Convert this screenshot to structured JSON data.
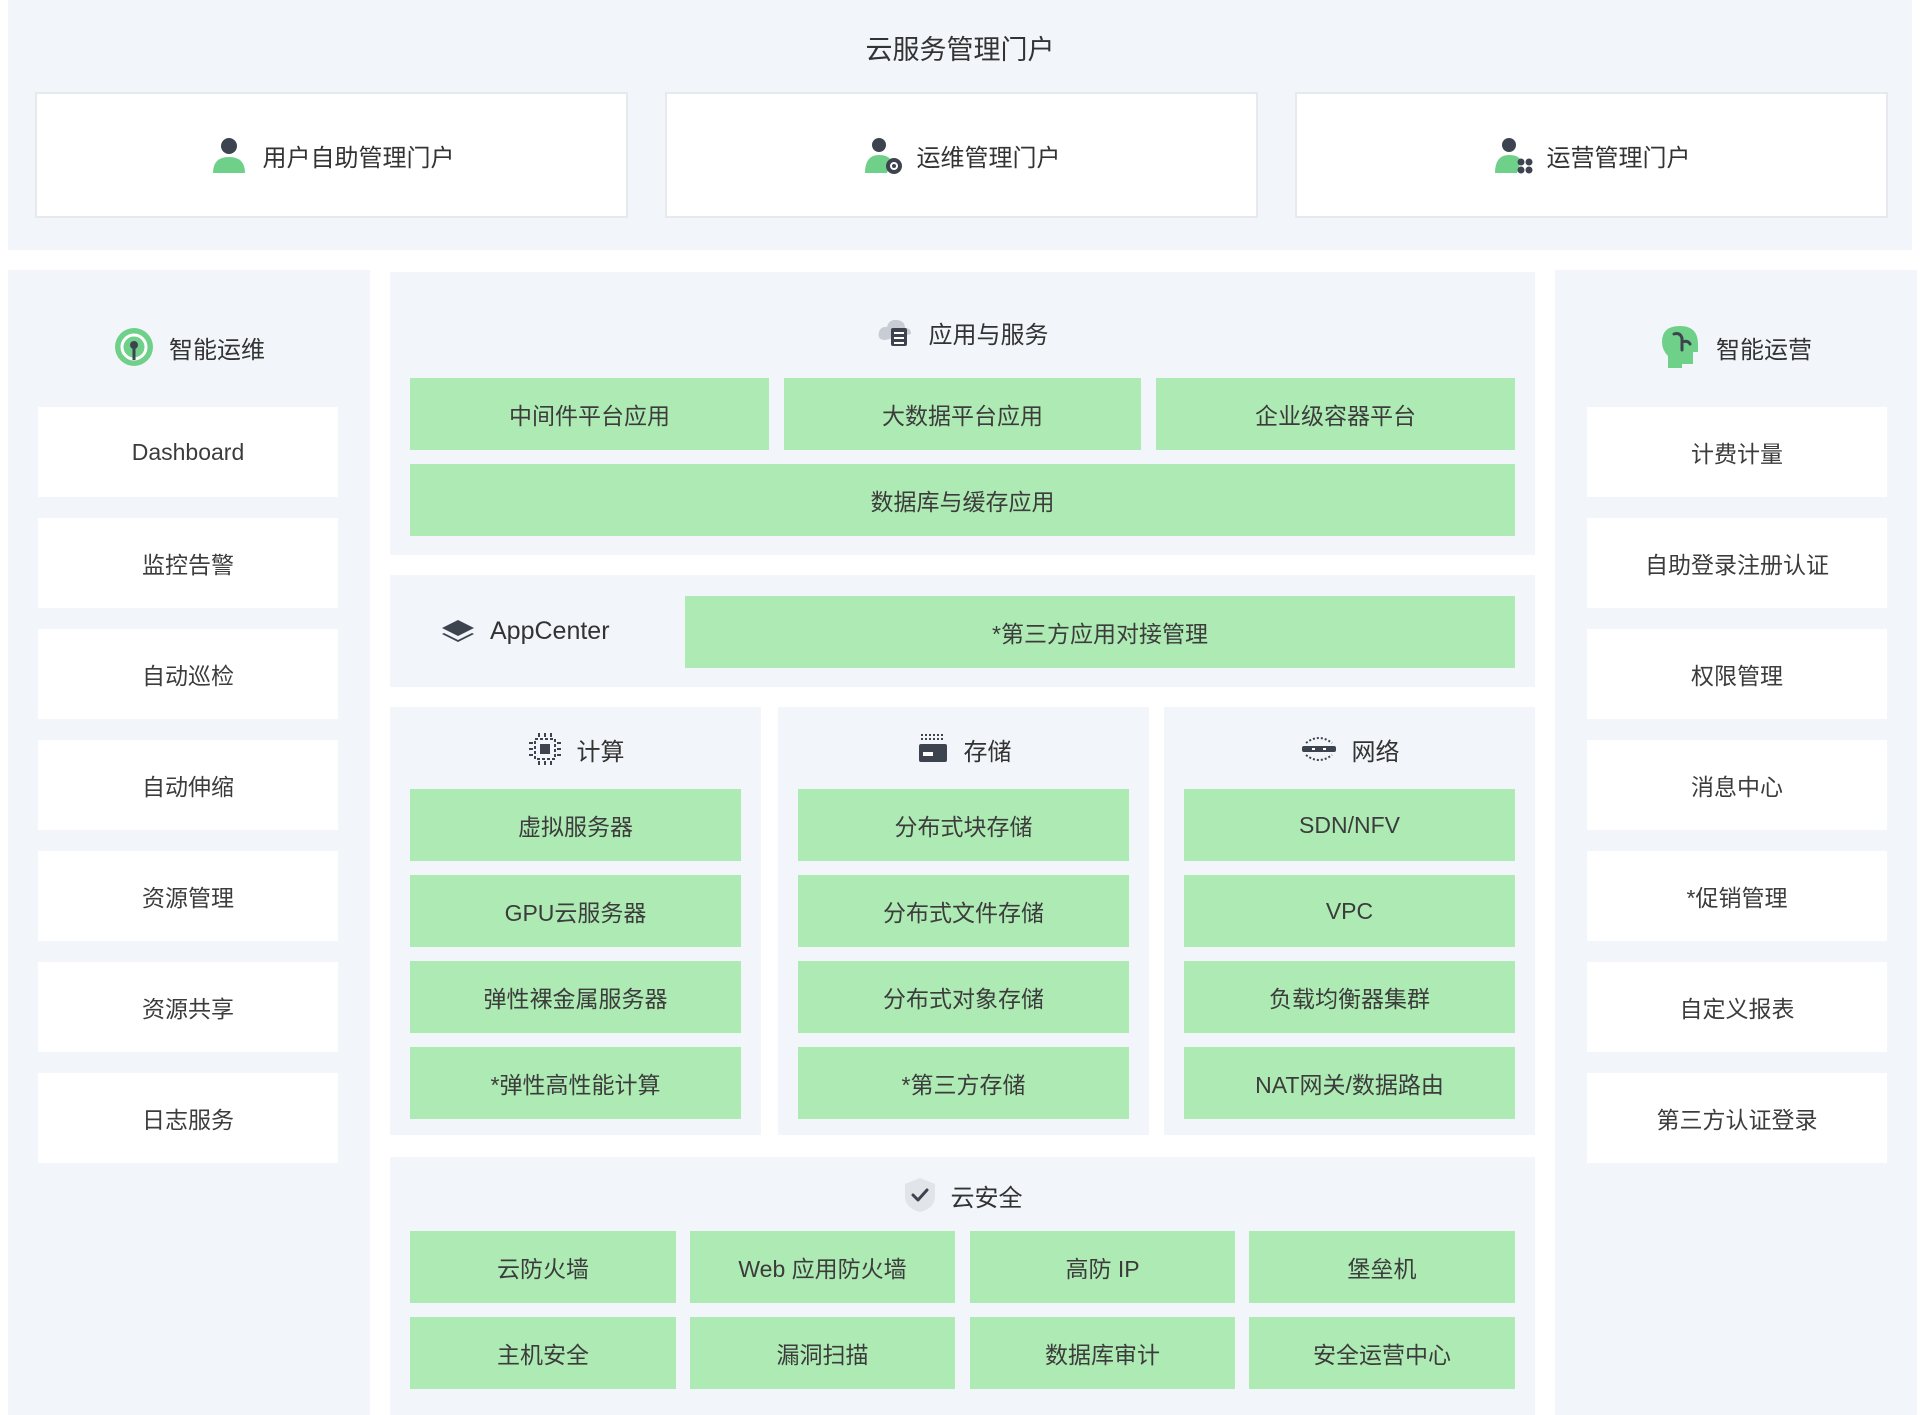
{
  "header": {
    "title": "云服务管理门户"
  },
  "portals": [
    {
      "label": "用户自助管理门户",
      "icon": "user-icon"
    },
    {
      "label": "运维管理门户",
      "icon": "user-gear-icon"
    },
    {
      "label": "运营管理门户",
      "icon": "user-apps-icon"
    }
  ],
  "left": {
    "title": "智能运维",
    "icon": "ops-antenna-icon",
    "items": [
      "Dashboard",
      "监控告警",
      "自动巡检",
      "自动伸缩",
      "资源管理",
      "资源共享",
      "日志服务"
    ]
  },
  "right": {
    "title": "智能运营",
    "icon": "head-brain-icon",
    "items": [
      "计费计量",
      "自助登录注册认证",
      "权限管理",
      "消息中心",
      "*促销管理",
      "自定义报表",
      "第三方认证登录"
    ]
  },
  "apps": {
    "title": "应用与服务",
    "icon": "cloud-server-icon",
    "row1": [
      "中间件平台应用",
      "大数据平台应用",
      "企业级容器平台"
    ],
    "row2": "数据库与缓存应用"
  },
  "appcenter": {
    "label": "AppCenter",
    "icon": "layers-icon",
    "item": "*第三方应用对接管理"
  },
  "compute": {
    "title": "计算",
    "icon": "chip-icon",
    "items": [
      "虚拟服务器",
      "GPU云服务器",
      "弹性裸金属服务器",
      "*弹性高性能计算"
    ]
  },
  "storage": {
    "title": "存储",
    "icon": "storage-icon",
    "items": [
      "分布式块存储",
      "分布式文件存储",
      "分布式对象存储",
      "*第三方存储"
    ]
  },
  "network": {
    "title": "网络",
    "icon": "network-icon",
    "items": [
      "SDN/NFV",
      "VPC",
      "负载均衡器集群",
      "NAT网关/数据路由"
    ]
  },
  "security": {
    "title": "云安全",
    "icon": "shield-check-icon",
    "items": [
      "云防火墙",
      "Web 应用防火墙",
      "高防 IP",
      "堡垒机",
      "主机安全",
      "漏洞扫描",
      "数据库审计",
      "安全运营中心"
    ]
  },
  "colors": {
    "green": "#aeeab3",
    "panel": "#f2f5f9",
    "icon_green": "#6fd189",
    "icon_dark": "#3d4450"
  }
}
